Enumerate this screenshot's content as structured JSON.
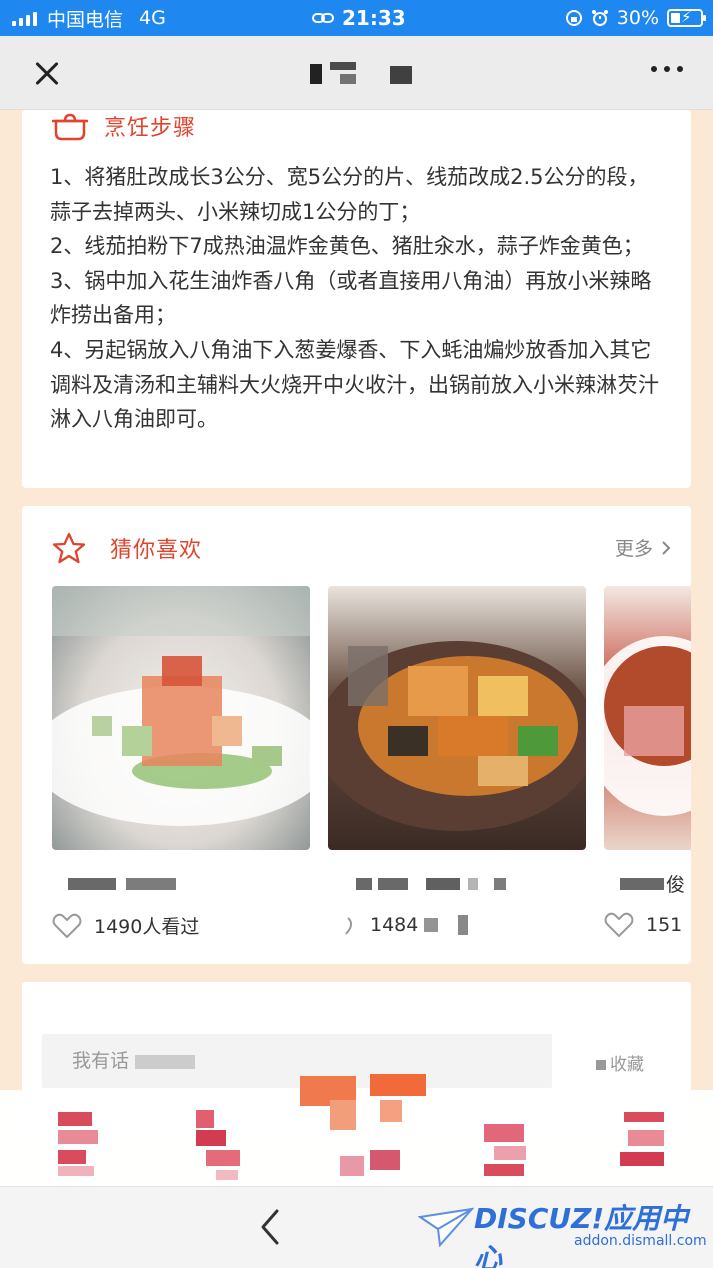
{
  "status_bar": {
    "carrier": "中国电信",
    "network": "4G",
    "time": "21:33",
    "battery": "30%"
  },
  "steps": {
    "title": "烹饪步骤",
    "items": [
      "1、将猪肚改成长3公分、宽5公分的片、线茄改成2.5公分的段，蒜子去掉两头、小米辣切成1公分的丁；",
      "2、线茄拍粉下7成热油温炸金黄色、猪肚汆水，蒜子炸金黄色；",
      "3、锅中加入花生油炸香八角（或者直接用八角油）再放小米辣略炸捞出备用；",
      "4、另起锅放入八角油下入葱姜爆香、下入蚝油煸炒放香加入其它调料及清汤和主辅料大火烧开中火收汁，出锅前放入小米辣淋芡汁淋入八角油即可。"
    ]
  },
  "guess": {
    "title": "猜你喜欢",
    "more": "更多",
    "items": [
      {
        "views": "1490人看过"
      },
      {
        "views": "1484"
      },
      {
        "name_visible": "俊",
        "views": "151"
      }
    ]
  },
  "comment": {
    "placeholder": "我有话",
    "collect": "收藏"
  },
  "watermark": {
    "logo": "DISCUZ!应用中心",
    "url": "addon.dismall.com"
  },
  "colors": {
    "accent": "#e2432c",
    "status_bar": "#1e87f0",
    "page_bg": "#fbe9d6"
  }
}
